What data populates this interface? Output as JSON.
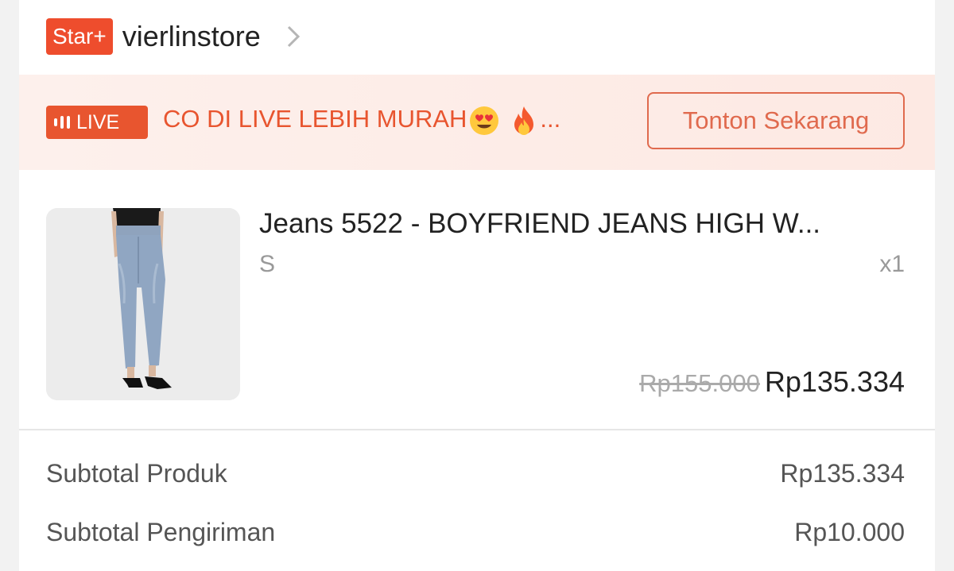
{
  "shop": {
    "badge": "Star+",
    "name": "vierlinstore"
  },
  "live_banner": {
    "badge": "LIVE",
    "text": "CO DI LIVE LEBIH MURAH",
    "ellipsis": "...",
    "emojis": [
      "heart-eyes-emoji",
      "fire-emoji"
    ],
    "button": "Tonton Sekarang"
  },
  "product": {
    "title": "Jeans 5522 - BOYFRIEND JEANS HIGH W...",
    "variant": "S",
    "quantity": "x1",
    "original_price": "Rp155.000",
    "price": "Rp135.334"
  },
  "summary": [
    {
      "label": "Subtotal Produk",
      "value": "Rp135.334"
    },
    {
      "label": "Subtotal Pengiriman",
      "value": "Rp10.000"
    }
  ],
  "colors": {
    "accent": "#ee4d2d",
    "live_text": "#e8552f"
  }
}
